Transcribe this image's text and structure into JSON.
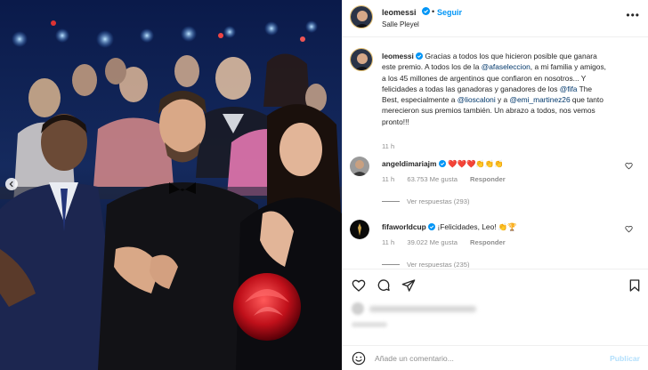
{
  "post": {
    "username": "leomessi",
    "follow_label": "Seguir",
    "separator": "•",
    "location": "Salle Pleyel",
    "more_label": "•••"
  },
  "caption": {
    "username": "leomessi",
    "text_1": "Gracias a todos los que hicieron posible que ganara este premio. A todos los de la ",
    "mention_1": "@afaseleccion",
    "text_2": ", a mi familia y amigos, a los 45 millones de argentinos que confiaron en nosotros... Y felicidades a todas las ganadoras y ganadores de los ",
    "mention_2": "@fifa",
    "text_3": " The Best, especialmente a ",
    "mention_3": "@lioscaloni",
    "text_4": " y a ",
    "mention_4": "@emi_martinez26",
    "text_5": " que tanto merecieron sus premios también. Un abrazo a todos, nos vemos pronto!!!",
    "time": "11 h"
  },
  "comments": [
    {
      "username": "angeldimariajm",
      "text": "❤️❤️❤️👏👏👏",
      "time": "11 h",
      "likes": "63.753 Me gusta",
      "reply_label": "Responder",
      "replies_label": "Ver respuestas (293)"
    },
    {
      "username": "fifaworldcup",
      "text": "¡Felicidades, Leo! 👏🏆",
      "time": "11 h",
      "likes": "39.022 Me gusta",
      "reply_label": "Responder",
      "replies_label": "Ver respuestas (235)"
    }
  ],
  "add_comment": {
    "placeholder": "Añade un comentario...",
    "publish_label": "Publicar"
  },
  "icons": {
    "verified": "verified-badge-icon",
    "heart": "heart-icon",
    "comment": "comment-icon",
    "share": "share-icon",
    "save": "bookmark-icon",
    "emoji": "emoji-icon",
    "prev": "chevron-left-icon"
  },
  "colors": {
    "link": "#0095f6",
    "mention": "#00376b",
    "muted": "#8e8e8e",
    "verified": "#0095f6"
  }
}
